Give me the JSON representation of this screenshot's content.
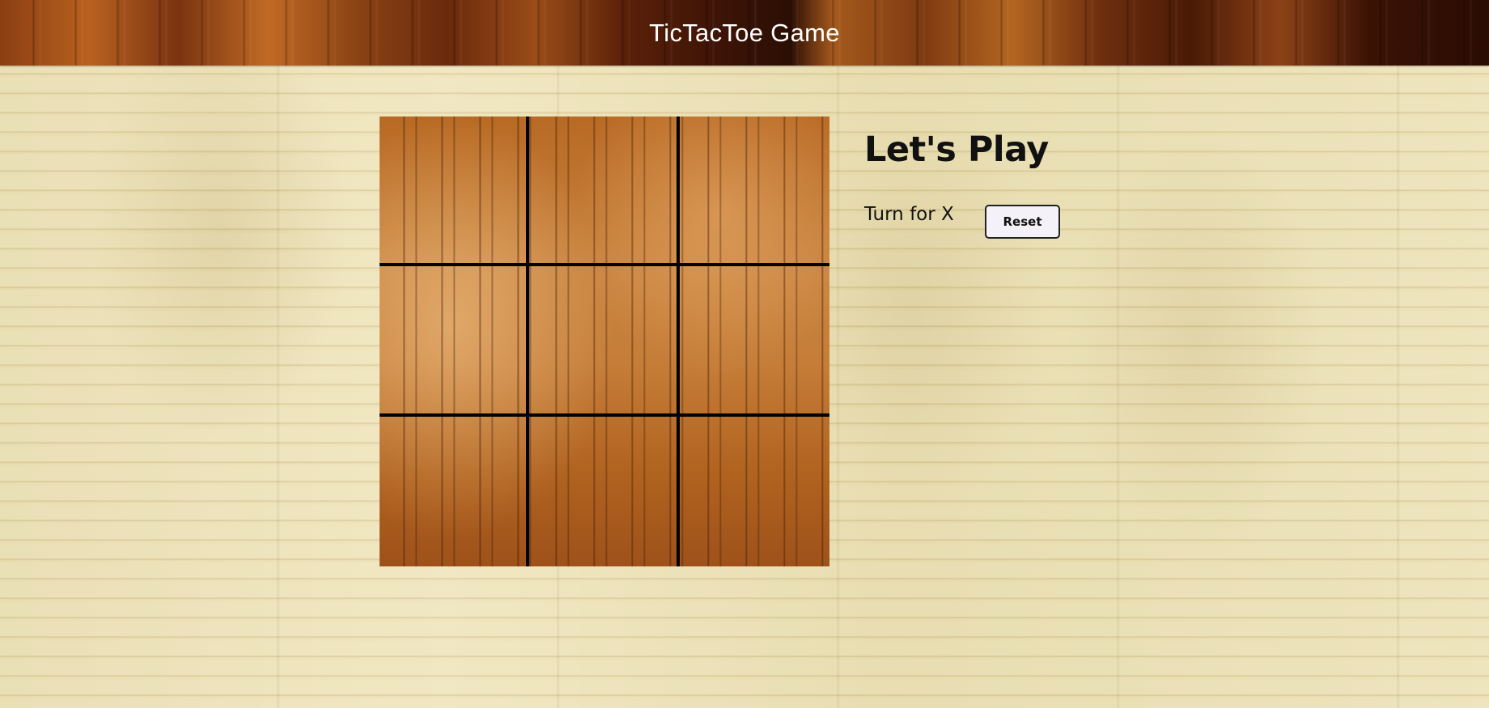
{
  "header": {
    "title": "TicTacToe Game"
  },
  "board": {
    "cells": [
      "",
      "",
      "",
      "",
      "",
      "",
      "",
      "",
      ""
    ]
  },
  "panel": {
    "heading": "Let's Play",
    "turn_text": "Turn for X",
    "reset_label": "Reset"
  },
  "colors": {
    "grid_line": "#000000",
    "text": "#111111",
    "header_text": "#ffffff"
  }
}
